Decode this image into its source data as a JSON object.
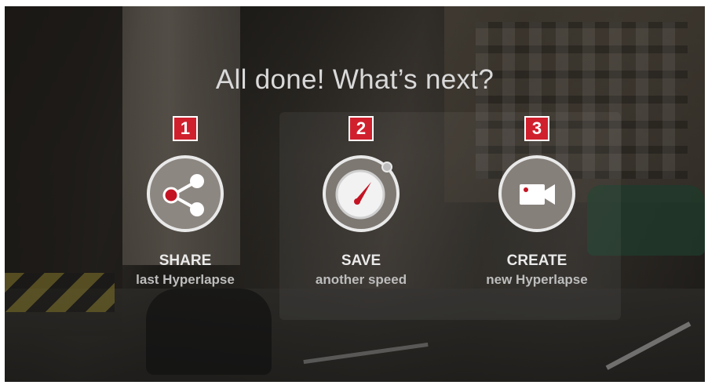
{
  "title": "All done! What’s next?",
  "accent_color": "#d0202e",
  "options": [
    {
      "badge": "1",
      "icon": "share-icon",
      "label": "SHARE",
      "sublabel": "last Hyperlapse"
    },
    {
      "badge": "2",
      "icon": "stopwatch-icon",
      "label": "SAVE",
      "sublabel": "another speed"
    },
    {
      "badge": "3",
      "icon": "video-camera-icon",
      "label": "CREATE",
      "sublabel": "new Hyperlapse"
    }
  ]
}
